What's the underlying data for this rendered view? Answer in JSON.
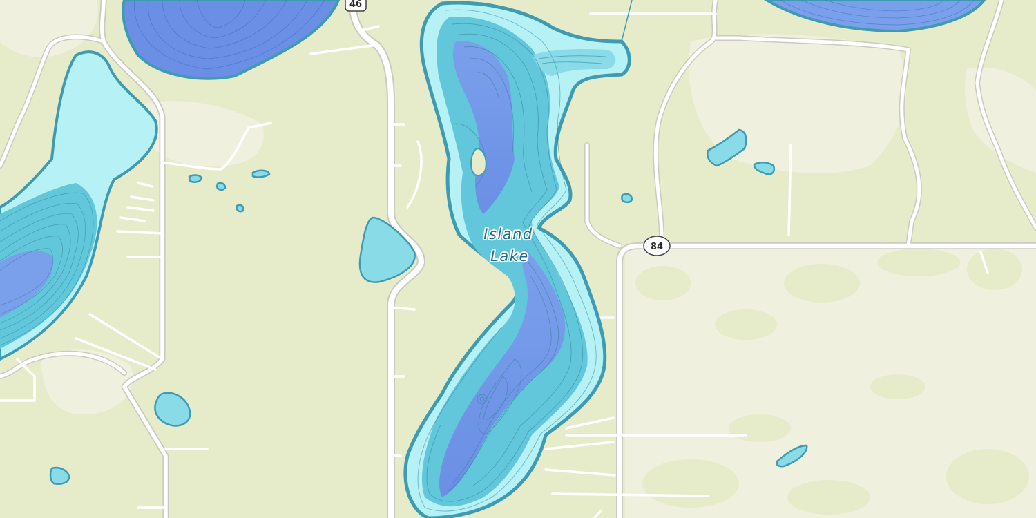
{
  "map": {
    "colors": {
      "land_light": "#f0f0df",
      "land_green": "#e6ebc9",
      "road_casing": "#c8c8c0",
      "road_fill": "#ffffff",
      "water_shallow": "#b6f1f5",
      "water_mid": "#63c7dc",
      "water_deep": "#6e92e6",
      "shore": "#3f9bb1",
      "contour": "#2f7f96",
      "label": "#1f6f86"
    },
    "labels": {
      "lake_name_line1": "Island",
      "lake_name_line2": "Lake"
    },
    "shields": {
      "route_46": "46",
      "route_84": "84"
    }
  }
}
